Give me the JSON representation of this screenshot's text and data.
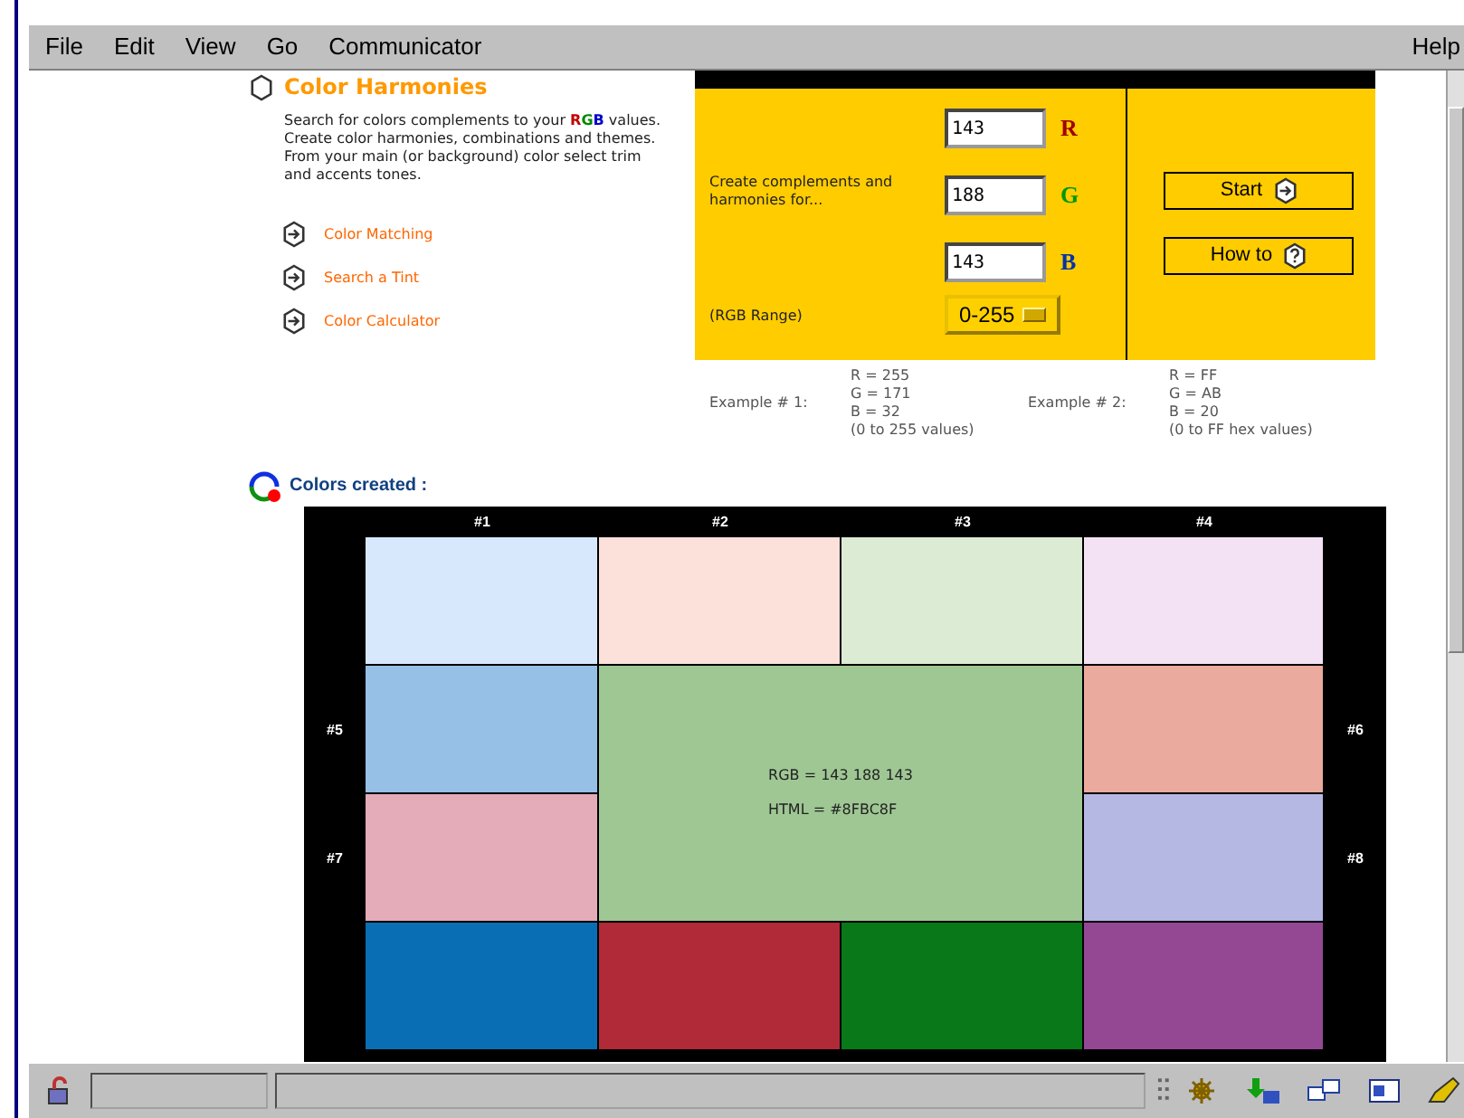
{
  "menu": {
    "items": [
      "File",
      "Edit",
      "View",
      "Go",
      "Communicator"
    ],
    "help": "Help"
  },
  "header": {
    "title": "Color Harmonies",
    "intro_before": "Search for colors complements to your ",
    "rgb_letters": [
      {
        "text": "R",
        "color": "#c00000"
      },
      {
        "text": "G",
        "color": "#008800"
      },
      {
        "text": "B",
        "color": "#0000cc"
      }
    ],
    "intro_after": " values. Create color harmonies, combinations and themes. From your main (or background) color select trim and accents tones."
  },
  "links": [
    "Color Matching",
    "Search a Tint",
    "Color Calculator"
  ],
  "rgb_form": {
    "prompt": "Create complements and harmonies for...",
    "fields": [
      {
        "value": "143",
        "channel": "R",
        "color": "#a00000"
      },
      {
        "value": "188",
        "channel": "G",
        "color": "#009900"
      },
      {
        "value": "143",
        "channel": "B",
        "color": "#0033aa"
      }
    ],
    "range_label": "(RGB Range)",
    "range_value": "0-255",
    "buttons": [
      {
        "label": "Start",
        "kind": "arrow"
      },
      {
        "label": "How to",
        "kind": "help"
      }
    ]
  },
  "examples": [
    {
      "label": "Example # 1:",
      "lines": [
        "R = 255",
        "G = 171",
        "B = 32",
        "(0 to 255 values)"
      ]
    },
    {
      "label": "Example # 2:",
      "lines": [
        "R = FF",
        "G = AB",
        "B = 20",
        "(0 to FF hex values)"
      ]
    }
  ],
  "colors_created": {
    "title": "Colors created :",
    "column_headers": [
      "#1",
      "#2",
      "#3",
      "#4"
    ],
    "top_swatches": [
      {
        "color": "#d8e8fc"
      },
      {
        "color": "#fce0da"
      },
      {
        "color": "#dcecd4"
      },
      {
        "color": "#f3e2f4"
      }
    ],
    "side_rows": [
      {
        "left": {
          "label": "#5",
          "color": "#96c0e6"
        },
        "right": {
          "label": "#6",
          "color": "#eaaa9e"
        }
      },
      {
        "left": {
          "label": "#7",
          "color": "#e4acb8"
        },
        "right": {
          "label": "#8",
          "color": "#b6b8e4"
        }
      }
    ],
    "center": {
      "color": "#9fc794",
      "lines": [
        "RGB = 143    188    143",
        "HTML = #8FBC8F"
      ]
    },
    "bottom_swatches": [
      {
        "color": "#0a6eb4"
      },
      {
        "color": "#b02a38"
      },
      {
        "color": "#087818"
      },
      {
        "color": "#944894"
      }
    ]
  }
}
